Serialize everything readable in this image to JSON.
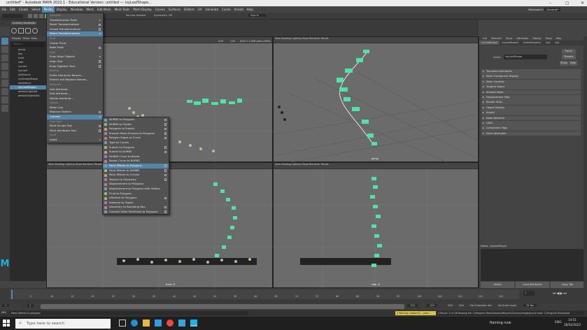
{
  "window": {
    "title": "untitled* - Autodesk MAYA 2022.1 - Educational Version: untitled --- ivyLeafShape..."
  },
  "menubar": [
    "File",
    "Edit",
    "Create",
    "Select",
    "Modify",
    "Display",
    "Windows",
    "Mesh",
    "Edit Mesh",
    "Mesh Tools",
    "Mesh Display",
    "Curves",
    "Surfaces",
    "Deform",
    "UV",
    "Generate",
    "Cache",
    "Arnold",
    "Help"
  ],
  "menubar_active": "Modify",
  "workspace": {
    "label": "Workspace:",
    "value": "General*"
  },
  "statusline": {
    "no_live_surface": "No Live Surface",
    "symmetry": "Symmetry: Off",
    "sign_in": "Sign In"
  },
  "shelf_tab": "Curves / Surfaces",
  "outliner": {
    "menus": [
      "Display",
      "Show",
      "Help"
    ],
    "search": "Search...",
    "items": [
      "persp",
      "top",
      "front",
      "side",
      "curve1",
      "ivyLeaf",
      "ivyBranch",
      "ivyStrokeShape",
      "strokeIvy1",
      "ivyLeafShape1",
      "defaultLightSet",
      "defaultObjectSet"
    ],
    "selected_index": 9
  },
  "modify_menu": {
    "items": [
      {
        "label": "Transform",
        "type": "hdr"
      },
      {
        "label": "Transformation Tools",
        "type": "arrow"
      },
      {
        "label": "Reset Transformations",
        "type": "box"
      },
      {
        "label": "Freeze Transformations",
        "type": "box"
      },
      {
        "label": "Match Transformations",
        "type": "arrow",
        "hl": true
      },
      {
        "label": "Pivot",
        "type": "hdr"
      },
      {
        "label": "Center Pivot",
        "type": "plain"
      },
      {
        "label": "Bake Pivot",
        "type": "box"
      },
      {
        "label": "Align",
        "type": "hdr"
      },
      {
        "label": "Snap Align Objects",
        "type": "arrow"
      },
      {
        "label": "Align Tool",
        "type": "box"
      },
      {
        "label": "Snap Together Tool",
        "type": "box"
      },
      {
        "label": "Naming",
        "type": "hdr"
      },
      {
        "label": "Prefix Hierarchy Names...",
        "type": "plain"
      },
      {
        "label": "Search and Replace Names...",
        "type": "plain"
      },
      {
        "label": "Attributes",
        "type": "hdr"
      },
      {
        "label": "Add Attribute...",
        "type": "plain"
      },
      {
        "label": "Edit Attribute...",
        "type": "plain"
      },
      {
        "label": "Delete Attribute...",
        "type": "plain"
      },
      {
        "label": "Objects",
        "type": "hdr"
      },
      {
        "label": "Make Live",
        "type": "plain"
      },
      {
        "label": "Replace Objects",
        "type": "box"
      },
      {
        "label": "Convert",
        "type": "arrow",
        "hl": true
      },
      {
        "label": "Paint Tools",
        "type": "hdr"
      },
      {
        "label": "Paint Scripts Tool",
        "type": "box"
      },
      {
        "label": "Paint Attributes Tool",
        "type": "box"
      },
      {
        "label": "Asset",
        "type": "hdr"
      },
      {
        "label": "Asset",
        "type": "arrow"
      }
    ]
  },
  "convert_menu": {
    "items": [
      {
        "label": "NURBS to Polygons",
        "box": true
      },
      {
        "label": "NURBS to Subdiv",
        "box": true
      },
      {
        "label": "Polygons to Subdiv",
        "box": true
      },
      {
        "label": "Smooth Mesh Preview to Polygons",
        "box": true
      },
      {
        "label": "Polygon Edges to Curve",
        "box": true
      },
      {
        "label": "Type to Curves",
        "box": false
      },
      {
        "label": "Subdiv to Polygons",
        "box": true
      },
      {
        "label": "Subdiv to NURBS",
        "box": true
      },
      {
        "label": "NURBS Curve to Bezier",
        "box": false
      },
      {
        "label": "Bezier Curve to NURBS",
        "box": false
      },
      {
        "label": "Paint Effects to Polygons",
        "box": true,
        "hl": true
      },
      {
        "label": "Paint Effects to NURBS",
        "box": true
      },
      {
        "label": "Paint Effects to Curves",
        "box": true
      },
      {
        "label": "Texture to Geometry",
        "box": true
      },
      {
        "label": "Displacement to Polygons",
        "box": false
      },
      {
        "label": "Displacement to Polygons with History",
        "box": false
      },
      {
        "label": "Fluid to Polygons",
        "box": false
      },
      {
        "label": "nParticle to Polygons",
        "box": true
      },
      {
        "label": "Instance to Object",
        "box": false
      },
      {
        "label": "Geometry to Bounding Box",
        "box": true
      },
      {
        "label": "Convert XGen Primitives to Polygons",
        "box": true
      }
    ]
  },
  "viewports": [
    {
      "label": "top -Y",
      "menus": [
        "View",
        "Shading",
        "Lighting",
        "Show",
        "Renderer",
        "Panels"
      ]
    },
    {
      "label": "persp",
      "menus": [
        "View",
        "Shading",
        "Lighting",
        "Show",
        "Renderer",
        "Panels"
      ]
    },
    {
      "label": "front -Z",
      "menus": [
        "View",
        "Shading",
        "Lighting",
        "Show",
        "Renderer",
        "Panels"
      ]
    },
    {
      "label": "side -X",
      "menus": [
        "View",
        "Shading",
        "Lighting",
        "Show",
        "Renderer",
        "Panels"
      ]
    }
  ],
  "viewport_stats": {
    "near": "0.00",
    "far": "1.00",
    "colorspace": "ACES 1.0 SDR-video (sRGB)"
  },
  "attribute_editor": {
    "menus": [
      "List",
      "Selected",
      "Focus",
      "Attributes",
      "Display",
      "Show",
      "Help"
    ],
    "tabs": [
      "ivyLeafShape",
      "ivyLeafShape1",
      "strokeShapeIvy",
      "ivy1",
      "ivyL"
    ],
    "field_label": "mesh:",
    "field_value": "ivyLeafShape",
    "focus_btn": "Focus",
    "presets_btn": "Presets",
    "show_btn": "Show",
    "hide_btn": "Hide",
    "sections": [
      "Transform Attributes",
      "Mesh Component Display",
      "Mesh Controls",
      "Tangent Space",
      "Smooth Mesh",
      "Displacement Map",
      "Render Stats",
      "Object Display",
      "Arnold",
      "Node Behavior",
      "UUID",
      "Component Tags",
      "Extra Attributes"
    ],
    "notes": "Notes: ivyLeafShape",
    "buttons": [
      "Select",
      "Load Attributes",
      "Copy Tab"
    ]
  },
  "timeline": {
    "ticks": [
      "5",
      "10",
      "15",
      "20",
      "25",
      "30",
      "35",
      "40",
      "45",
      "50",
      "55",
      "60",
      "65",
      "70",
      "75",
      "80",
      "85",
      "90",
      "95",
      "100",
      "105",
      "110",
      "115",
      "120"
    ],
    "current_frame": "1"
  },
  "range": {
    "start": "1",
    "start2": "1",
    "end": "120",
    "end2": "120",
    "end3": "200",
    "end4": "200",
    "no_char_set": "No Character Set",
    "no_anim_layer": "No Anim Layer",
    "fps": "24 fps"
  },
  "cmdline": {
    "lang": "MEL",
    "help": "Paint effects to polygons",
    "warning": "// Warning: [xibbanX] ...prop...",
    "result": "// Result: 11.9 GB Reading file: C:/Program Files/Autodesk/Maya2022/icons/images/ivy.tif  read: 'C:/Program Files/Autod"
  },
  "taskbar": {
    "search_placeholder": "Type here to search",
    "weather": "Raining now",
    "lang": "ENG",
    "time": "14:51",
    "date": "28/02/2022"
  },
  "colors": {
    "accent": "#5285a6",
    "leaf": "#4fe3a8",
    "viewport_bg": "#6b6b6b"
  }
}
